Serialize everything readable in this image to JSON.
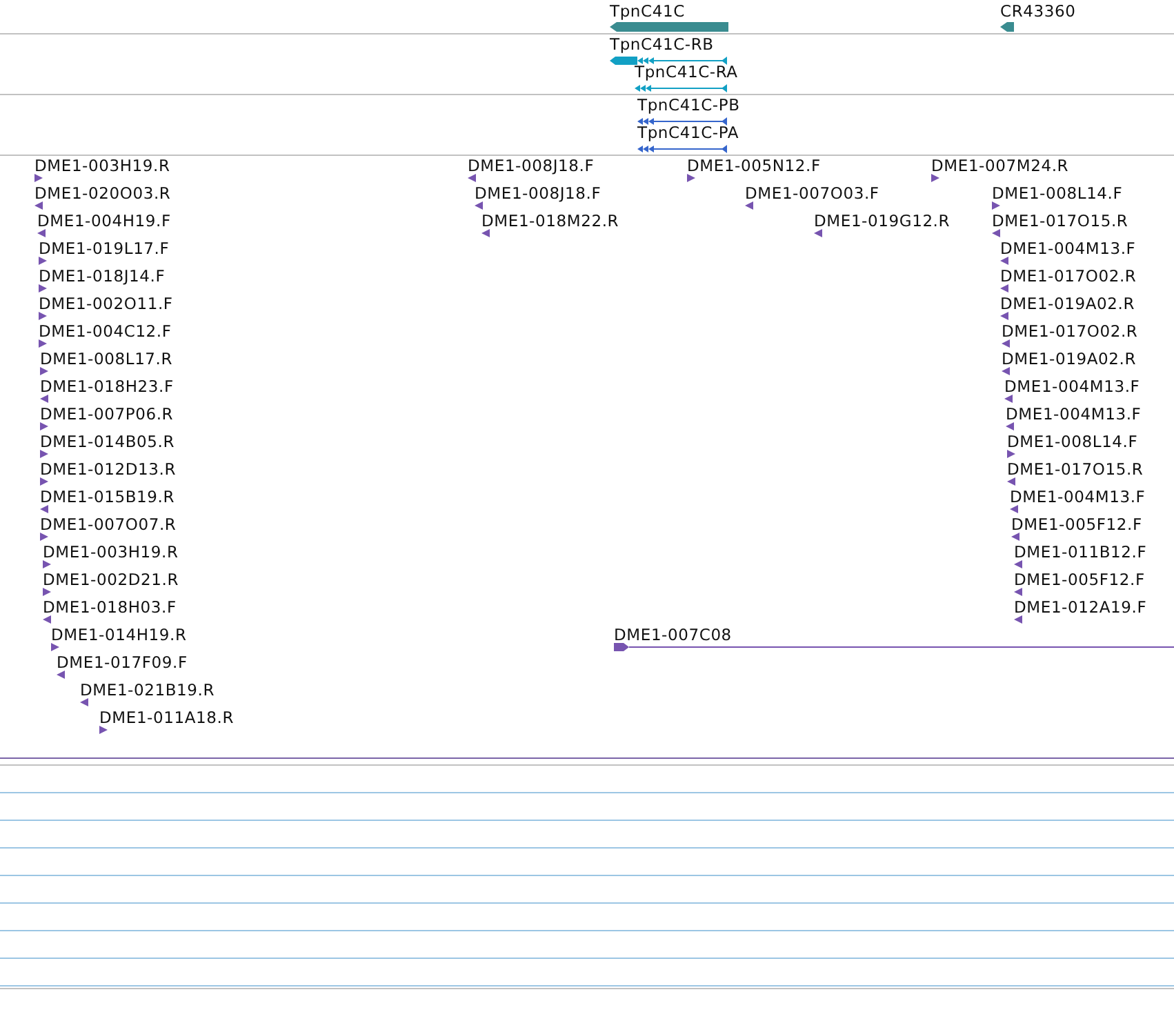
{
  "genes": [
    {
      "label": "TpnC41C",
      "kind": "long"
    },
    {
      "label": "CR43360",
      "kind": "short"
    }
  ],
  "transcripts": [
    {
      "label": "TpnC41C-RB",
      "kind": "block"
    },
    {
      "label": "TpnC41C-RA",
      "kind": "plain"
    }
  ],
  "proteins": [
    {
      "label": "TpnC41C-PB",
      "kind": "plain"
    },
    {
      "label": "TpnC41C-PA",
      "kind": "plain"
    }
  ],
  "clones": [
    {
      "label": "DME1-003H19.R",
      "reverse": false,
      "kind": "point"
    },
    {
      "label": "DME1-020O03.R",
      "reverse": true,
      "kind": "point"
    },
    {
      "label": "DME1-004H19.F",
      "reverse": true,
      "kind": "point"
    },
    {
      "label": "DME1-019L17.F",
      "reverse": false,
      "kind": "point"
    },
    {
      "label": "DME1-018J14.F",
      "reverse": false,
      "kind": "point"
    },
    {
      "label": "DME1-002O11.F",
      "reverse": false,
      "kind": "point"
    },
    {
      "label": "DME1-004C12.F",
      "reverse": false,
      "kind": "point"
    },
    {
      "label": "DME1-008L17.R",
      "reverse": false,
      "kind": "point"
    },
    {
      "label": "DME1-018H23.F",
      "reverse": true,
      "kind": "point"
    },
    {
      "label": "DME1-007P06.R",
      "reverse": false,
      "kind": "point"
    },
    {
      "label": "DME1-014B05.R",
      "reverse": false,
      "kind": "point"
    },
    {
      "label": "DME1-012D13.R",
      "reverse": false,
      "kind": "point"
    },
    {
      "label": "DME1-015B19.R",
      "reverse": true,
      "kind": "point"
    },
    {
      "label": "DME1-007O07.R",
      "reverse": false,
      "kind": "point"
    },
    {
      "label": "DME1-003H19.R",
      "reverse": false,
      "kind": "point"
    },
    {
      "label": "DME1-002D21.R",
      "reverse": false,
      "kind": "point"
    },
    {
      "label": "DME1-018H03.F",
      "reverse": true,
      "kind": "point"
    },
    {
      "label": "DME1-014H19.R",
      "reverse": false,
      "kind": "point"
    },
    {
      "label": "DME1-017F09.F",
      "reverse": true,
      "kind": "point"
    },
    {
      "label": "DME1-021B19.R",
      "reverse": true,
      "kind": "point"
    },
    {
      "label": "DME1-011A18.R",
      "reverse": false,
      "kind": "point"
    },
    {
      "label": "DME1-008J18.F",
      "reverse": true,
      "kind": "point"
    },
    {
      "label": "DME1-008J18.F",
      "reverse": true,
      "kind": "point"
    },
    {
      "label": "DME1-018M22.R",
      "reverse": true,
      "kind": "point"
    },
    {
      "label": "DME1-005N12.F",
      "reverse": false,
      "kind": "point"
    },
    {
      "label": "DME1-007O03.F",
      "reverse": true,
      "kind": "point"
    },
    {
      "label": "DME1-019G12.R",
      "reverse": true,
      "kind": "point"
    },
    {
      "label": "DME1-007M24.R",
      "reverse": false,
      "kind": "point"
    },
    {
      "label": "DME1-008L14.F",
      "reverse": false,
      "kind": "point"
    },
    {
      "label": "DME1-017O15.R",
      "reverse": true,
      "kind": "point"
    },
    {
      "label": "DME1-004M13.F",
      "reverse": true,
      "kind": "point"
    },
    {
      "label": "DME1-017O02.R",
      "reverse": true,
      "kind": "point"
    },
    {
      "label": "DME1-019A02.R",
      "reverse": true,
      "kind": "point"
    },
    {
      "label": "DME1-017O02.R",
      "reverse": true,
      "kind": "point"
    },
    {
      "label": "DME1-019A02.R",
      "reverse": true,
      "kind": "point"
    },
    {
      "label": "DME1-004M13.F",
      "reverse": true,
      "kind": "point"
    },
    {
      "label": "DME1-004M13.F",
      "reverse": true,
      "kind": "point"
    },
    {
      "label": "DME1-008L14.F",
      "reverse": false,
      "kind": "point"
    },
    {
      "label": "DME1-017O15.R",
      "reverse": true,
      "kind": "point"
    },
    {
      "label": "DME1-004M13.F",
      "reverse": true,
      "kind": "point"
    },
    {
      "label": "DME1-005F12.F",
      "reverse": true,
      "kind": "point"
    },
    {
      "label": "DME1-011B12.F",
      "reverse": true,
      "kind": "point"
    },
    {
      "label": "DME1-005F12.F",
      "reverse": true,
      "kind": "point"
    },
    {
      "label": "DME1-012A19.F",
      "reverse": true,
      "kind": "point"
    },
    {
      "label": "DME1-007C08",
      "reverse": false,
      "kind": "span"
    }
  ]
}
